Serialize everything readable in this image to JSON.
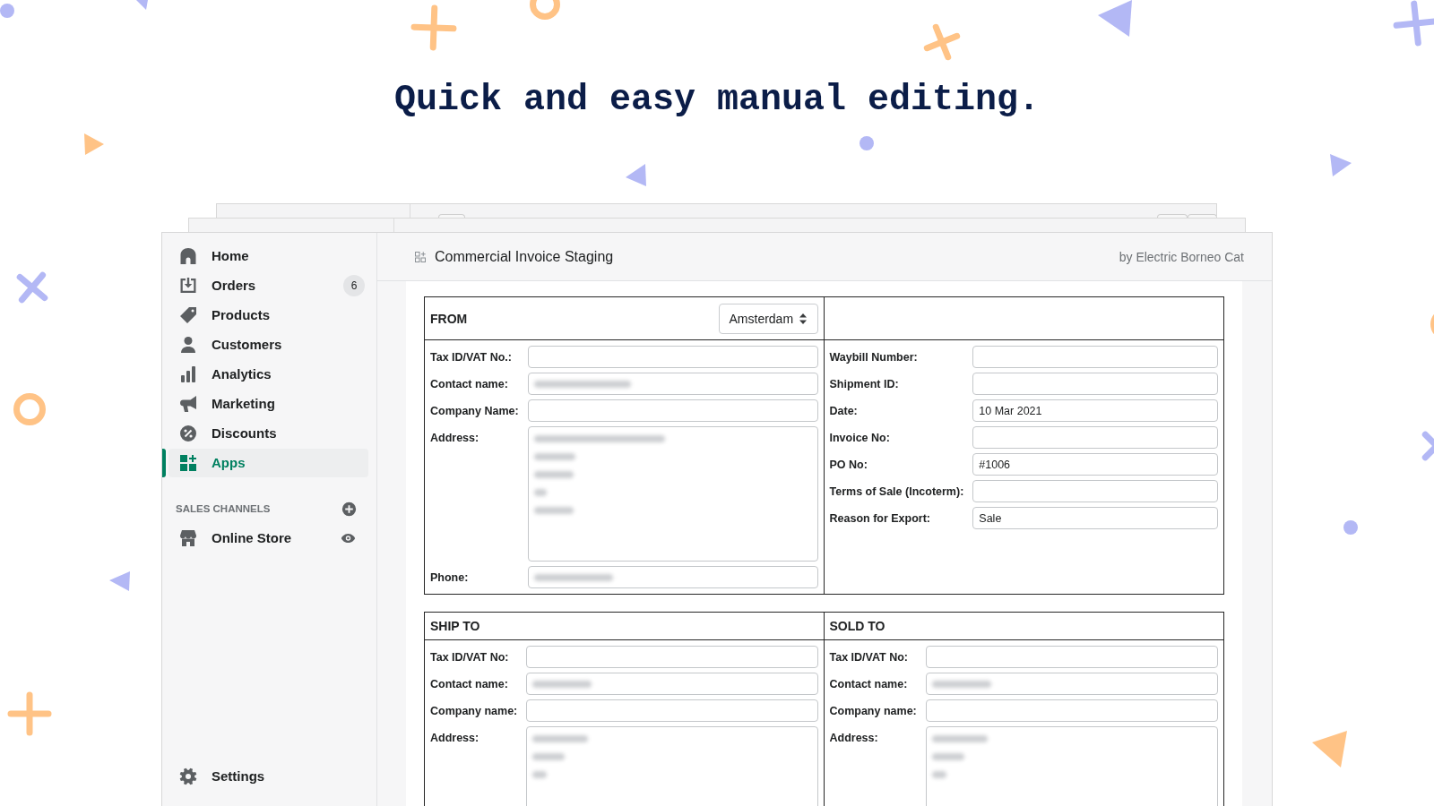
{
  "headline": "Quick and easy manual editing.",
  "sidebar": {
    "items": [
      {
        "label": "Home",
        "selected": false
      },
      {
        "label": "Orders",
        "badge": "6",
        "selected": false
      },
      {
        "label": "Products",
        "selected": false
      },
      {
        "label": "Customers",
        "selected": false
      },
      {
        "label": "Analytics",
        "selected": false
      },
      {
        "label": "Marketing",
        "selected": false
      },
      {
        "label": "Discounts",
        "selected": false
      },
      {
        "label": "Apps",
        "selected": true
      }
    ],
    "sales_channels": {
      "heading": "SALES CHANNELS",
      "items": [
        {
          "label": "Online Store"
        }
      ]
    },
    "settings": {
      "label": "Settings"
    }
  },
  "app_header": {
    "title": "Commercial Invoice Staging",
    "byline": "by Electric Borneo Cat"
  },
  "from_section": {
    "title": "FROM",
    "location_select": {
      "value": "Amsterdam"
    },
    "fields": [
      {
        "label": "Tax ID/VAT No.:",
        "kind": "input",
        "blurred": false
      },
      {
        "label": "Contact name:",
        "kind": "input",
        "blurred": true
      },
      {
        "label": "Company Name:",
        "kind": "input",
        "blurred": false
      },
      {
        "label": "Address:",
        "kind": "textarea",
        "lines": [
          {
            "kind": "blurred"
          },
          {
            "kind": "blurred"
          },
          {
            "kind": "blurred"
          },
          {
            "kind": "blurred"
          },
          {
            "kind": "blurred"
          }
        ]
      },
      {
        "label": "Phone:",
        "kind": "input",
        "blurred": true
      }
    ],
    "shipment_fields": [
      {
        "label": "Waybill Number:",
        "kind": "input",
        "blurred": false
      },
      {
        "label": "Shipment ID:",
        "kind": "input",
        "blurred": false
      },
      {
        "label": "Date:",
        "kind": "input",
        "value": "10 Mar 2021",
        "blurred": false
      },
      {
        "label": "Invoice No:",
        "kind": "input",
        "blurred": false
      },
      {
        "label": "PO No:",
        "kind": "input",
        "value": "#1006",
        "blurred": false
      },
      {
        "label": "Terms of Sale (Incoterm):",
        "kind": "input",
        "blurred": false
      },
      {
        "label": "Reason for Export:",
        "kind": "input",
        "value": "Sale",
        "blurred": false
      }
    ]
  },
  "parties": [
    {
      "title": "SHIP TO",
      "fields": [
        {
          "label": "Tax ID/VAT No:",
          "kind": "input",
          "blurred": false
        },
        {
          "label": "Contact name:",
          "kind": "input",
          "blurred": true
        },
        {
          "label": "Company name:",
          "kind": "input",
          "blurred": false
        },
        {
          "label": "Address:",
          "kind": "textarea",
          "lines": [
            {
              "kind": "blurred"
            },
            {
              "kind": "blurred"
            },
            {
              "kind": "blurred"
            }
          ]
        }
      ]
    },
    {
      "title": "SOLD TO",
      "fields": [
        {
          "label": "Tax ID/VAT No:",
          "kind": "input",
          "blurred": false
        },
        {
          "label": "Contact name:",
          "kind": "input",
          "blurred": true
        },
        {
          "label": "Company name:",
          "kind": "input",
          "blurred": false
        },
        {
          "label": "Address:",
          "kind": "textarea",
          "lines": [
            {
              "kind": "blurred"
            },
            {
              "kind": "blurred"
            },
            {
              "kind": "blurred"
            }
          ]
        }
      ]
    }
  ]
}
